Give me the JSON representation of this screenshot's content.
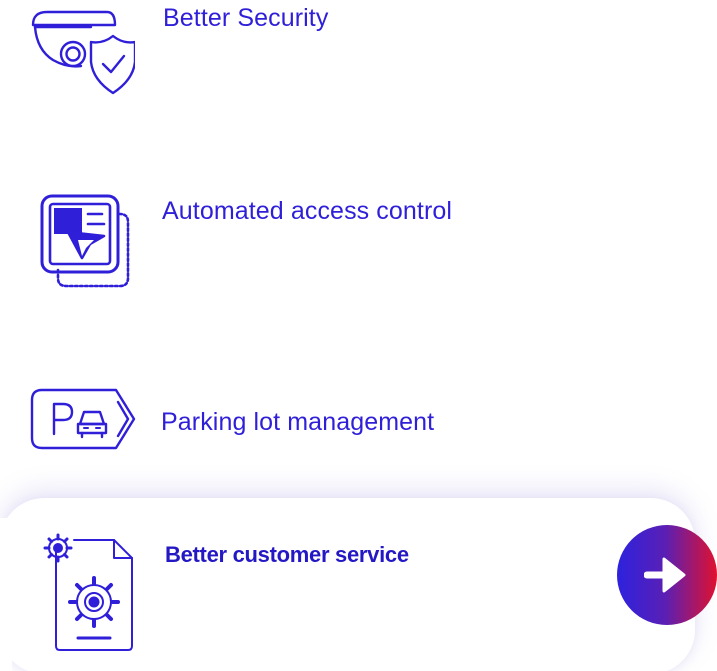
{
  "features": {
    "items": [
      {
        "label": "Better Security",
        "icon": "security-camera-shield-icon"
      },
      {
        "label": "Automated access control",
        "icon": "access-control-document-icon"
      },
      {
        "label": "Parking lot management",
        "icon": "parking-car-icon"
      },
      {
        "label": "Better customer service",
        "icon": "customer-service-gears-document-icon",
        "active": true
      }
    ]
  },
  "next_button": {
    "icon": "arrow-right-icon"
  },
  "colors": {
    "accent": "#2f1fd8",
    "active_text": "#2418c4",
    "button_gradient_start": "#2d22de",
    "button_gradient_end": "#e0112f"
  }
}
